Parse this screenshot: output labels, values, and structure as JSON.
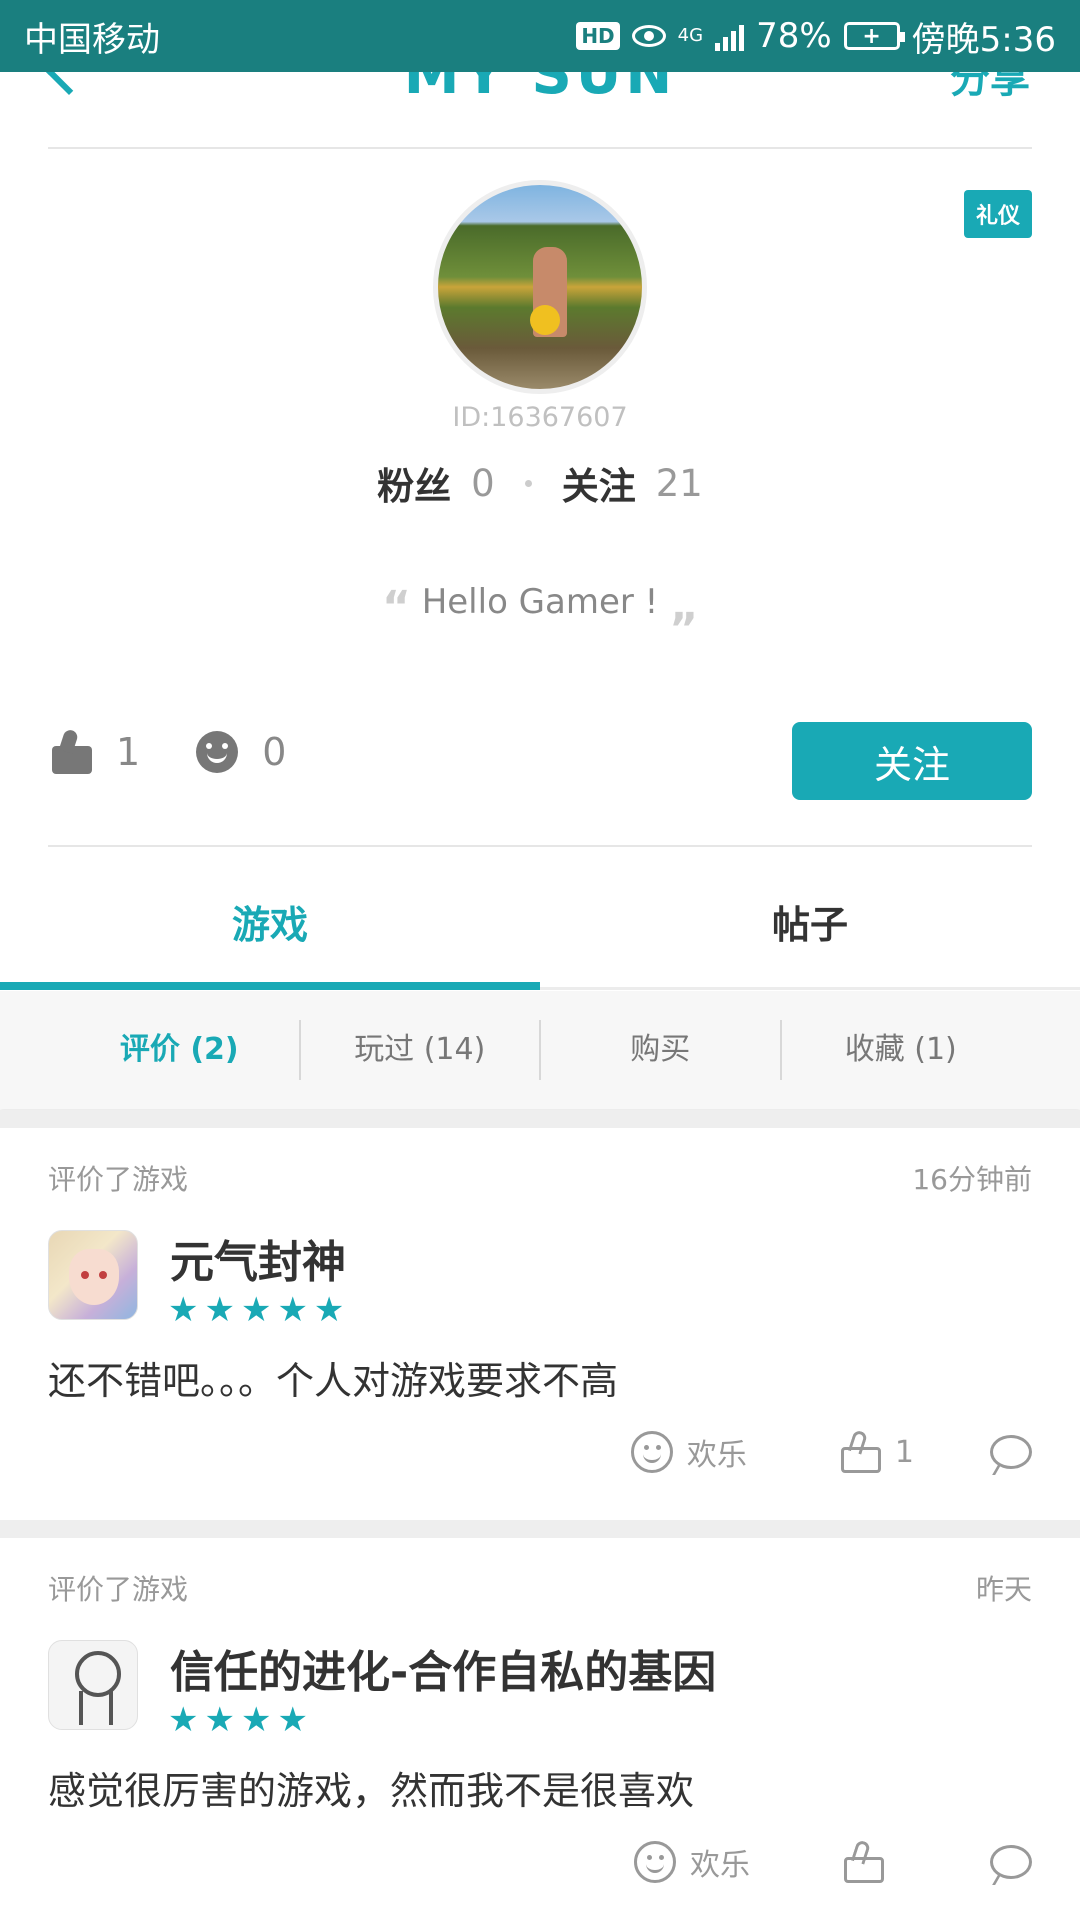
{
  "status_bar": {
    "carrier": "中国移动",
    "hd": "HD",
    "network": "4G",
    "battery": "78%",
    "time": "傍晚5:36"
  },
  "header": {
    "back_icon": "chevron-left-icon",
    "title": "MY SUN",
    "share": "分享"
  },
  "profile": {
    "badge": "礼仪",
    "uid": "ID:16367607",
    "fans_label": "粉丝",
    "fans_count": "0",
    "follow_label": "关注",
    "follow_count": "21",
    "quote": "Hello Gamer !",
    "likes": "1",
    "happy": "0",
    "follow_button": "关注"
  },
  "tabs": [
    {
      "label": "游戏",
      "active": true
    },
    {
      "label": "帖子",
      "active": false
    }
  ],
  "subtabs": [
    {
      "label": "评价 (2)",
      "active": true
    },
    {
      "label": "玩过 (14)",
      "active": false
    },
    {
      "label": "购买",
      "active": false
    },
    {
      "label": "收藏 (1)",
      "active": false
    }
  ],
  "reviews": [
    {
      "action": "评价了游戏",
      "time": "16分钟前",
      "game": "元气封神",
      "stars": "★★★★★",
      "text": "还不错吧。。。个人对游戏要求不高",
      "mood": "欢乐",
      "likes": "1"
    },
    {
      "action": "评价了游戏",
      "time": "昨天",
      "game": "信任的进化-合作自私的基因",
      "stars": "★★★★",
      "text": "感觉很厉害的游戏，然而我不是很喜欢",
      "mood": "欢乐",
      "likes": ""
    }
  ],
  "colors": {
    "accent": "#19a9b5",
    "status_bar": "#1a7f7f"
  }
}
